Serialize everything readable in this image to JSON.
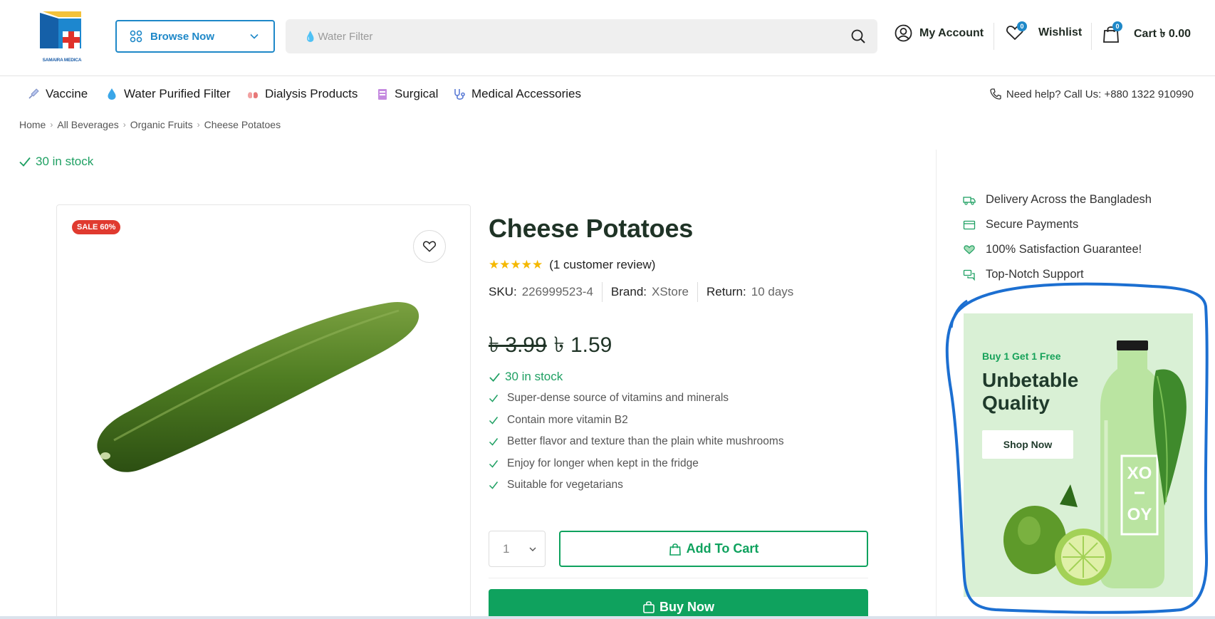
{
  "brand": {
    "logo_text": "SAMAIRA MEDICA"
  },
  "header": {
    "browse_label": "Browse Now",
    "search_placeholder": "Water Filter",
    "account_label": "My Account",
    "wishlist_label": "Wishlist",
    "wishlist_count": "0",
    "cart_label": "Cart ৳ 0.00",
    "cart_count": "0"
  },
  "nav": {
    "items": [
      {
        "label": "Vaccine",
        "icon": "syringe-icon"
      },
      {
        "label": "Water Purified Filter",
        "icon": "water-drop-icon"
      },
      {
        "label": "Dialysis Products",
        "icon": "lungs-icon"
      },
      {
        "label": "Surgical",
        "icon": "clipboard-icon"
      },
      {
        "label": "Medical Accessories",
        "icon": "stethoscope-icon"
      }
    ],
    "help_text": "Need help? Call Us: +880 1322 910990"
  },
  "breadcrumb": [
    "Home",
    "All Beverages",
    "Organic Fruits",
    "Cheese Potatoes"
  ],
  "stock_top": "30 in stock",
  "product": {
    "sale_badge": "SALE 60%",
    "title": "Cheese Potatoes",
    "rating": 5,
    "review_text": "(1 customer review)",
    "sku_label": "SKU:",
    "sku_value": "226999523-4",
    "brand_label": "Brand:",
    "brand_value": "XStore",
    "return_label": "Return:",
    "return_value": "10 days",
    "old_price": "৳ 3.99",
    "new_price": "৳ 1.59",
    "stock": "30 in stock",
    "features": [
      "Super-dense source of vitamins and minerals",
      "Contain more vitamin B2",
      "Better flavor and texture than the plain white mushrooms",
      "Enjoy for longer when kept in the fridge",
      "Suitable for vegetarians"
    ],
    "quantity": "1",
    "add_to_cart_label": "Add To Cart",
    "buy_now_label": "Buy Now"
  },
  "sidebar": {
    "perks": [
      {
        "label": "Delivery Across the Bangladesh",
        "icon": "truck-icon"
      },
      {
        "label": "Secure Payments",
        "icon": "card-icon"
      },
      {
        "label": "100% Satisfaction Guarantee!",
        "icon": "heart-hand-icon"
      },
      {
        "label": "Top-Notch Support",
        "icon": "chat-icon"
      }
    ],
    "banner": {
      "small": "Buy 1 Get 1 Free",
      "title": "Unbetable Quality",
      "button": "Shop Now",
      "bottle_text_1": "XO",
      "bottle_text_2": "OY"
    }
  },
  "colors": {
    "accent_blue": "#1e88c8",
    "accent_green": "#0fa25e",
    "sale_red": "#e03a2f",
    "annotation_blue": "#1c6fd1"
  }
}
